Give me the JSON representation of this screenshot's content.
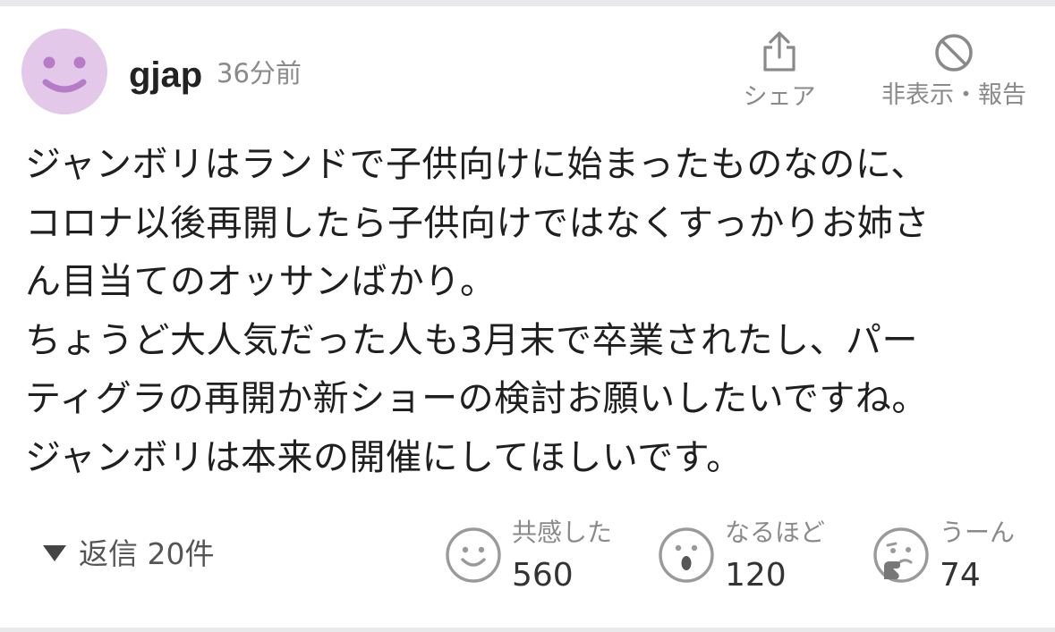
{
  "comment": {
    "user": {
      "name": "gjap",
      "avatar_icon": "smiley-avatar-icon",
      "avatar_color": "#e3c8ea"
    },
    "time_ago": "36分前",
    "actions": {
      "share_label": "シェア",
      "share_icon": "share-icon",
      "report_label": "非表示・報告",
      "report_icon": "prohibited-icon"
    },
    "body_lines": [
      "ジャンボリはランドで子供向けに始まったものなのに、",
      "コロナ以後再開したら子供向けではなくすっかりお姉さ",
      "ん目当てのオッサンばかり。",
      "ちょうど大人気だった人も3月末で卒業されたし、パー",
      "ティグラの再開か新ショーの検討お願いしたいですね。",
      "ジャンボリは本来の開催にしてほしいです。"
    ],
    "replies_label": "返信 20件",
    "reactions": [
      {
        "label": "共感した",
        "count": "560",
        "icon": "smile-face-icon"
      },
      {
        "label": "なるほど",
        "count": "120",
        "icon": "surprised-face-icon"
      },
      {
        "label": "うーん",
        "count": "74",
        "icon": "thinking-face-icon"
      }
    ]
  }
}
